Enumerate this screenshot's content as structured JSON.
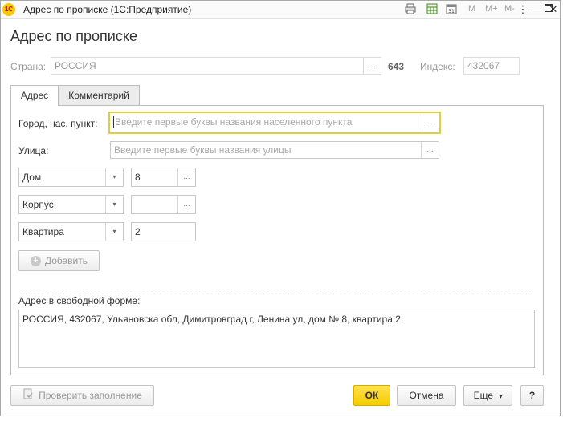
{
  "window": {
    "title": "Адрес по прописке  (1С:Предприятие)",
    "logo_text": "1С",
    "toolbar": {
      "m": "M",
      "m_plus": "M+",
      "m_minus": "M-"
    },
    "controls": {
      "menu": "⋮",
      "minimize": "—",
      "maximize": "☐",
      "close": "✕"
    }
  },
  "form": {
    "title": "Адрес по прописке",
    "country_label": "Страна:",
    "country_value": "РОССИЯ",
    "country_code": "643",
    "index_label": "Индекс:",
    "index_value": "432067",
    "ellipsis": "...",
    "tabs": [
      {
        "label": "Адрес"
      },
      {
        "label": "Комментарий"
      }
    ],
    "city_label": "Город, нас. пункт:",
    "city_placeholder": "Введите первые буквы названия населенного пункта",
    "street_label": "Улица:",
    "street_placeholder": "Введите первые буквы названия улицы",
    "house": {
      "type": "Дом",
      "value": "8"
    },
    "building": {
      "type": "Корпус",
      "value": ""
    },
    "apartment": {
      "type": "Квартира",
      "value": "2"
    },
    "add_button": "Добавить",
    "freeform_label": "Адрес в свободной форме:",
    "freeform_value": "РОССИЯ, 432067, Ульяновска обл, Димитровград г, Ленина ул, дом № 8, квартира 2"
  },
  "footer": {
    "check_button": "Проверить заполнение",
    "ok_button": "ОК",
    "cancel_button": "Отмена",
    "more_button": "Еще",
    "help_button": "?"
  },
  "icons": {
    "dropdown": "▾",
    "add": "+"
  }
}
